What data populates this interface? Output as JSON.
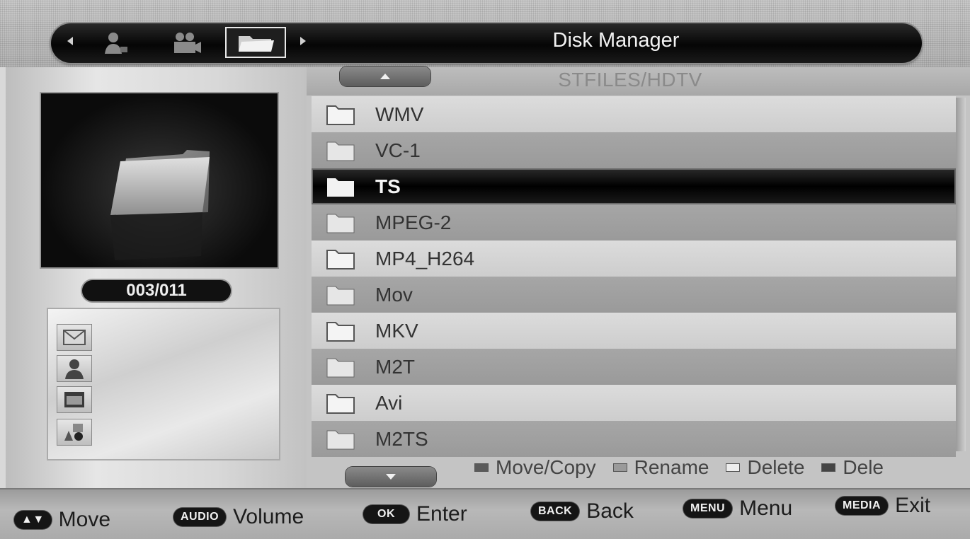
{
  "header": {
    "title": "Disk Manager",
    "tabs": [
      {
        "icon": "person-icon"
      },
      {
        "icon": "camera-icon"
      },
      {
        "icon": "folder-icon",
        "selected": true
      }
    ]
  },
  "browser": {
    "path": "STFILES/HDTV",
    "counter": "003/011",
    "files": [
      {
        "name": "WMV"
      },
      {
        "name": "VC-1"
      },
      {
        "name": "TS",
        "selected": true
      },
      {
        "name": "MPEG-2"
      },
      {
        "name": "MP4_H264"
      },
      {
        "name": "Mov"
      },
      {
        "name": "MKV"
      },
      {
        "name": "M2T"
      },
      {
        "name": "Avi"
      },
      {
        "name": "M2TS"
      }
    ],
    "side_icons": [
      "mail-icon",
      "person-icon",
      "folder-icon",
      "shapes-icon"
    ]
  },
  "legend": {
    "move_copy": "Move/Copy",
    "rename": "Rename",
    "delete": "Delete",
    "delete_all": "Dele"
  },
  "footer": {
    "move_key": "▲▼",
    "move_label": "Move",
    "audio_key": "AUDIO",
    "audio_label": "Volume",
    "ok_key": "OK",
    "ok_label": "Enter",
    "back_key": "BACK",
    "back_label": "Back",
    "menu_key": "MENU",
    "menu_label": "Menu",
    "media_key": "MEDIA",
    "media_label": "Exit"
  },
  "colors": {
    "selected_row": "#000000",
    "row_light": "#d6d6d6",
    "row_dark": "#a0a0a0",
    "legend_move_copy": "#5a5a5a",
    "legend_rename": "#9a9a9a",
    "legend_delete": "#eeeeee",
    "legend_delete_all": "#444444"
  }
}
